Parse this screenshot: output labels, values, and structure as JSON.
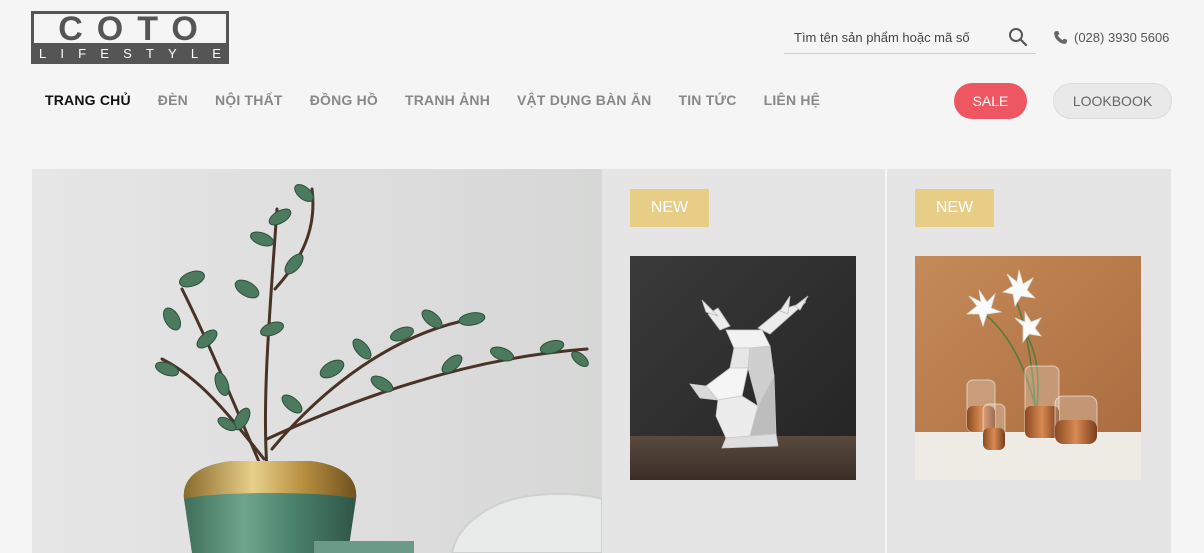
{
  "logo": {
    "word": "COTO",
    "sub": [
      "L",
      "I",
      "F",
      "E",
      "S",
      "T",
      "Y",
      "L",
      "E"
    ]
  },
  "search": {
    "placeholder": "Tìm tên sản phẩm hoặc mã số",
    "icon": "search-icon"
  },
  "phone": {
    "number": "(028) 3930 5606",
    "icon": "phone-icon"
  },
  "nav": {
    "items": [
      {
        "label": "TRANG CHỦ",
        "active": true
      },
      {
        "label": "ĐÈN"
      },
      {
        "label": "NỘI THẤT"
      },
      {
        "label": "ĐỒNG HỒ"
      },
      {
        "label": "TRANH ẢNH"
      },
      {
        "label": "VẬT DỤNG BÀN ĂN"
      },
      {
        "label": "TIN TỨC"
      },
      {
        "label": "LIÊN HỆ"
      }
    ],
    "sale_label": "SALE",
    "lookbook_label": "LOOKBOOK"
  },
  "colors": {
    "sale": "#ee5662",
    "badge": "#e8cd86",
    "text_muted": "#888888"
  },
  "products": [
    {
      "badge": "NEW",
      "image": "white geometric deer head sculpture"
    },
    {
      "badge": "NEW",
      "image": "glass vases with white lilies"
    }
  ],
  "hero": {
    "image": "green and gold vase with leafy branches"
  }
}
